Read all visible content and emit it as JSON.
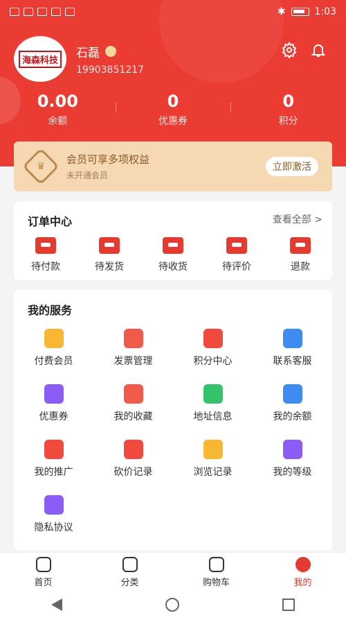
{
  "status_bar": {
    "time": "1:03"
  },
  "profile": {
    "avatar_text": "海森科技",
    "name": "石磊",
    "phone": "19903851217"
  },
  "stats": [
    {
      "value": "0.00",
      "label": "余额"
    },
    {
      "value": "0",
      "label": "优惠券"
    },
    {
      "value": "0",
      "label": "积分"
    }
  ],
  "vip": {
    "title": "会员可享多项权益",
    "subtitle": "未开通会员",
    "button": "立即激活"
  },
  "orders": {
    "title": "订单中心",
    "more": "查看全部 >",
    "items": [
      "待付款",
      "待发货",
      "待收货",
      "待评价",
      "退款"
    ]
  },
  "services": {
    "title": "我的服务",
    "items": [
      {
        "label": "付费会员",
        "color": "#f7b733"
      },
      {
        "label": "发票管理",
        "color": "#ef5b4b"
      },
      {
        "label": "积分中心",
        "color": "#ef4a3d"
      },
      {
        "label": "联系客服",
        "color": "#3f8cf0"
      },
      {
        "label": "优惠券",
        "color": "#8b5cf6"
      },
      {
        "label": "我的收藏",
        "color": "#ef5b4b"
      },
      {
        "label": "地址信息",
        "color": "#34c26b"
      },
      {
        "label": "我的余额",
        "color": "#3f8cf0"
      },
      {
        "label": "我的推广",
        "color": "#ef4a3d"
      },
      {
        "label": "砍价记录",
        "color": "#ef4a3d"
      },
      {
        "label": "浏览记录",
        "color": "#f7b733"
      },
      {
        "label": "我的等级",
        "color": "#8b5cf6"
      },
      {
        "label": "隐私协议",
        "color": "#8b5cf6"
      }
    ]
  },
  "tabbar": [
    "首页",
    "分类",
    "购物车",
    "我的"
  ],
  "colors": {
    "brand": "#ea3c32",
    "vip_bg": "#f6d8b3",
    "accent_text": "#8a5a28"
  }
}
